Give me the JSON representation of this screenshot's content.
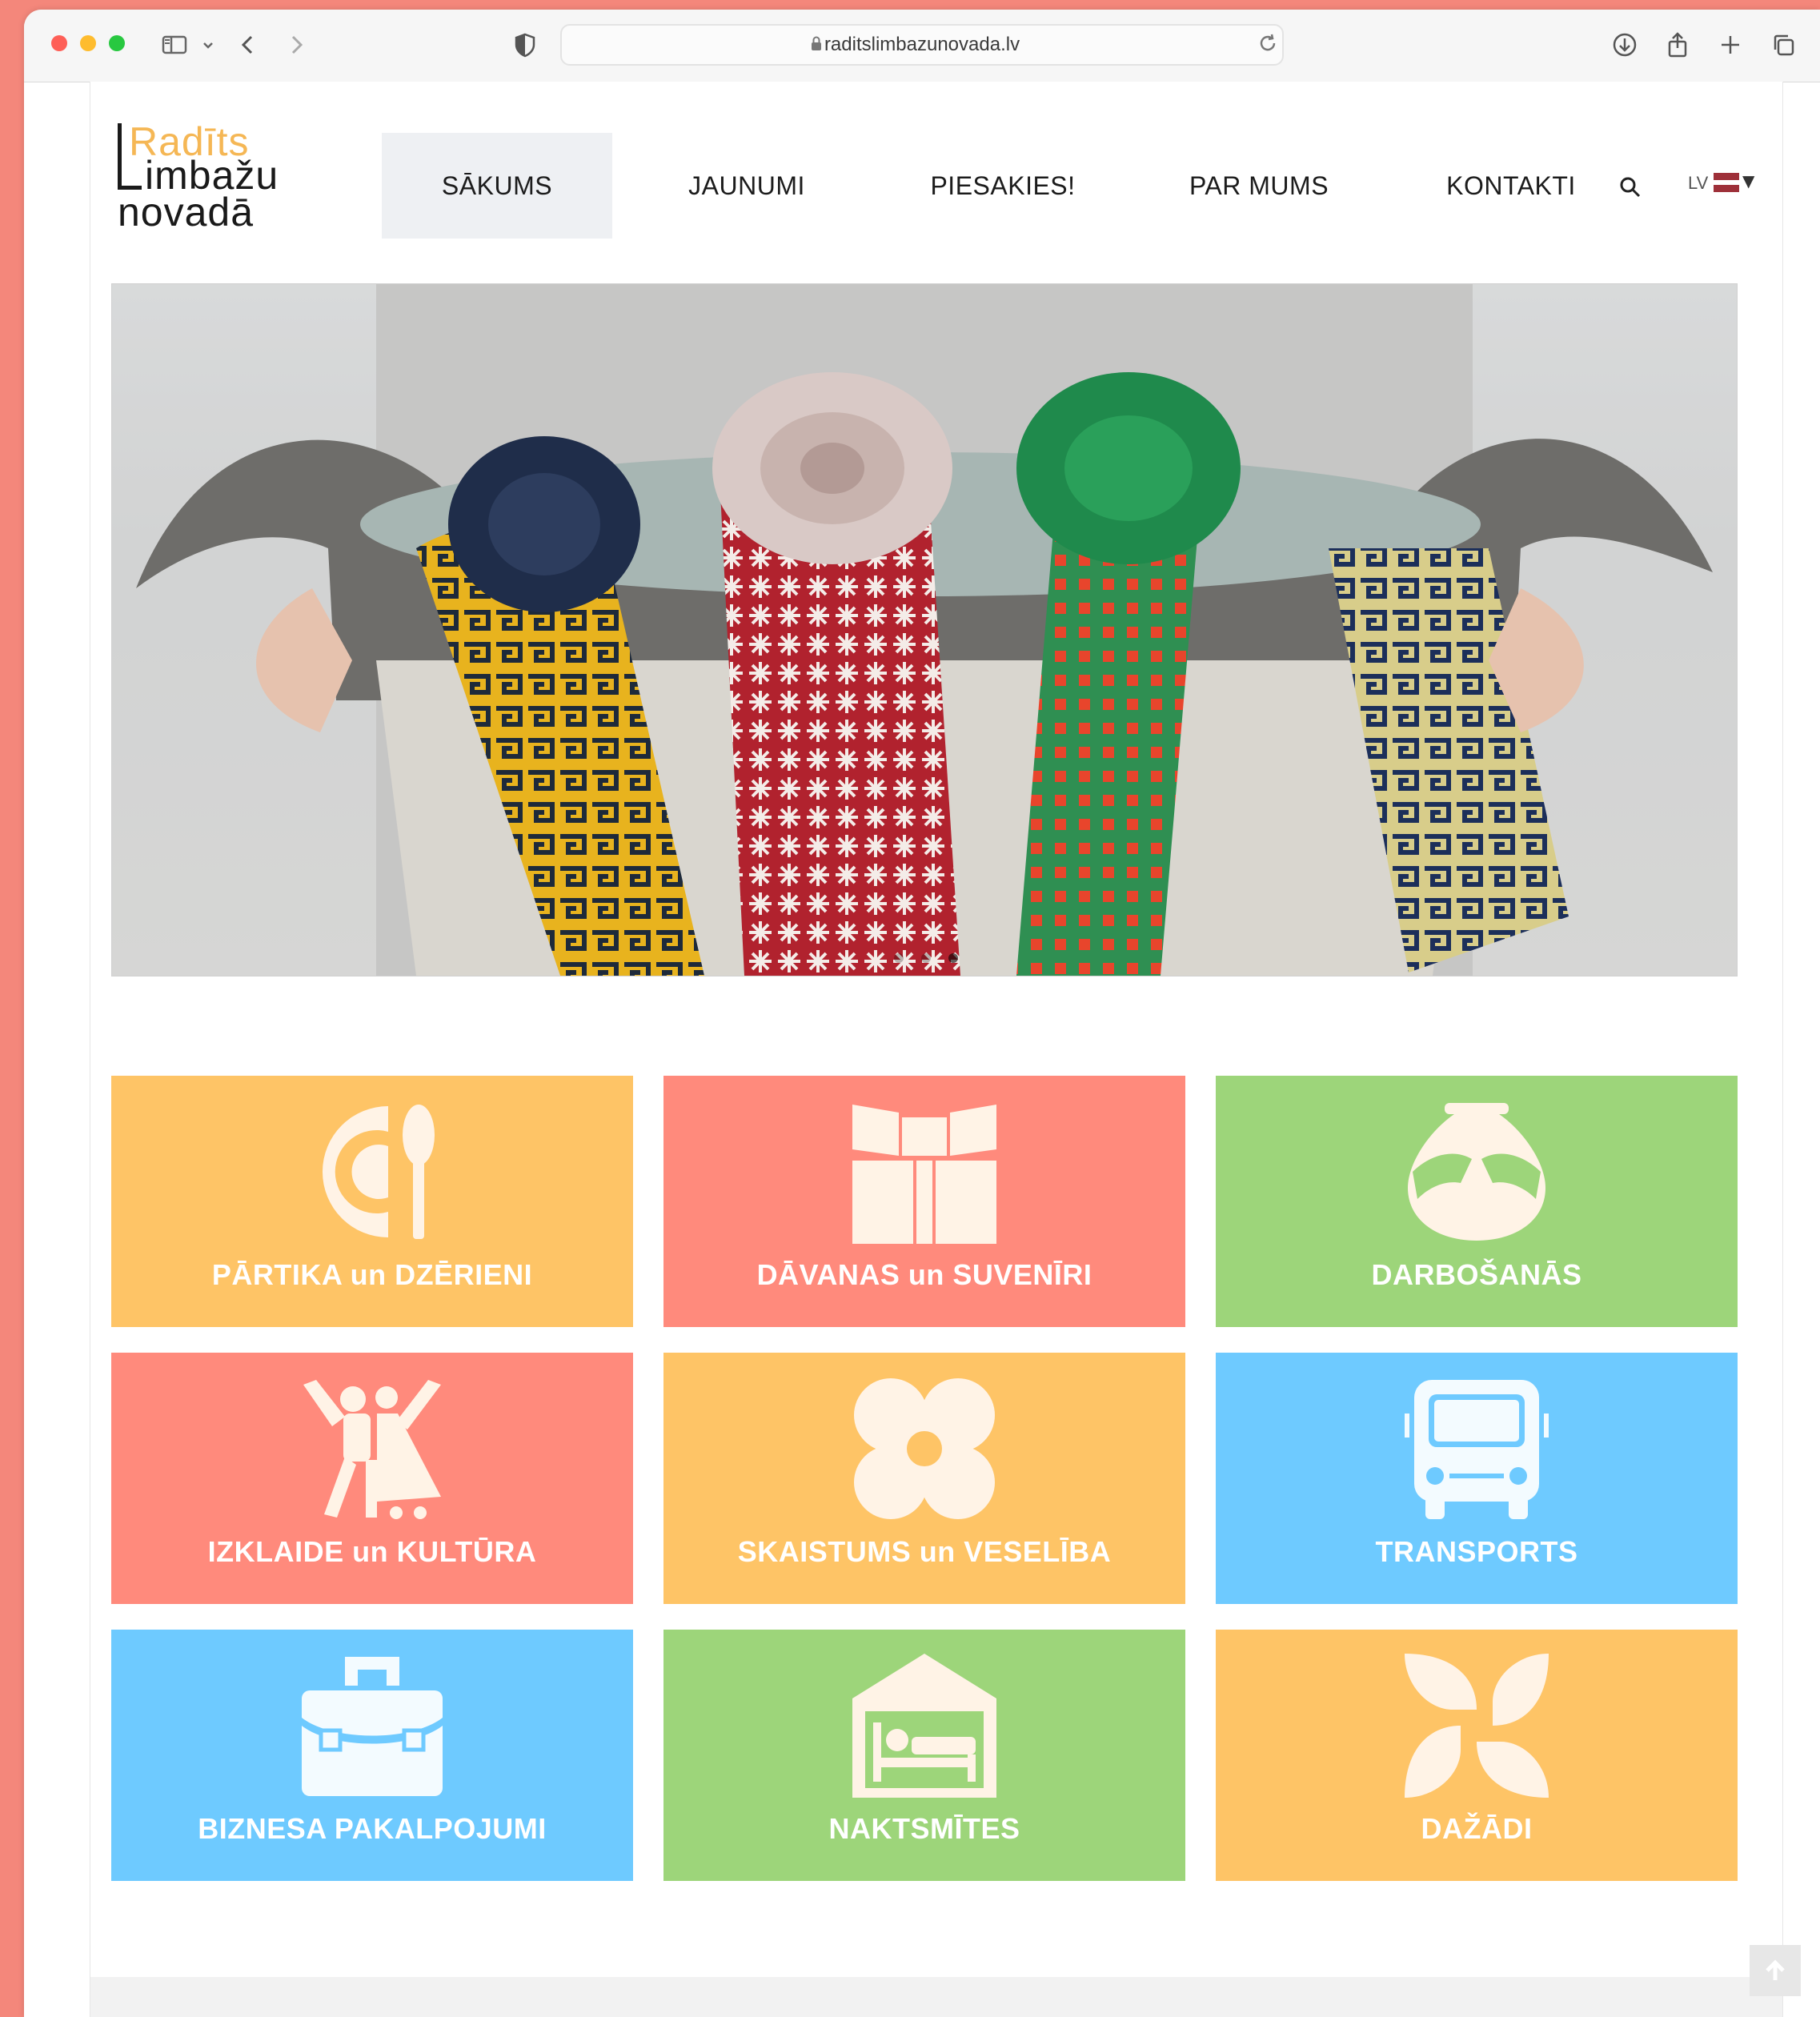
{
  "browser": {
    "url": "raditslimbazunovada.lv"
  },
  "logo": {
    "line1": "Radīts",
    "line2": "imbažu",
    "line3": "novadā"
  },
  "nav": {
    "items": [
      {
        "label": "SĀKUMS",
        "active": true
      },
      {
        "label": "JAUNUMI",
        "active": false
      },
      {
        "label": "PIESAKIES!",
        "active": false
      },
      {
        "label": "PAR MUMS",
        "active": false
      },
      {
        "label": "KONTAKTI",
        "active": false
      }
    ],
    "lang": "LV"
  },
  "colors": {
    "yellow": "#fec466",
    "coral": "#ff8a7c",
    "green": "#9dd57a",
    "blue": "#6ecaff",
    "icon_tint": "#fff3e6"
  },
  "categories": [
    {
      "label": "PĀRTIKA un DZĒRIENI",
      "icon": "plate-spoon-icon",
      "color": "#fec466"
    },
    {
      "label": "DĀVANAS un SUVENĪRI",
      "icon": "gift-icon",
      "color": "#ff8a7c"
    },
    {
      "label": "DARBOŠANĀS",
      "icon": "pottery-hands-icon",
      "color": "#9dd57a"
    },
    {
      "label": "IZKLAIDE un KULTŪRA",
      "icon": "dancers-icon",
      "color": "#ff8a7c"
    },
    {
      "label": "SKAISTUMS un VESELĪBA",
      "icon": "flower-icon",
      "color": "#fec466"
    },
    {
      "label": "TRANSPORTS",
      "icon": "bus-icon",
      "color": "#6ecaff"
    },
    {
      "label": "BIZNESA PAKALPOJUMI",
      "icon": "briefcase-icon",
      "color": "#6ecaff"
    },
    {
      "label": "NAKTSMĪTES",
      "icon": "house-bed-icon",
      "color": "#9dd57a"
    },
    {
      "label": "DAŽĀDI",
      "icon": "pinwheel-icon",
      "color": "#fec466"
    }
  ]
}
